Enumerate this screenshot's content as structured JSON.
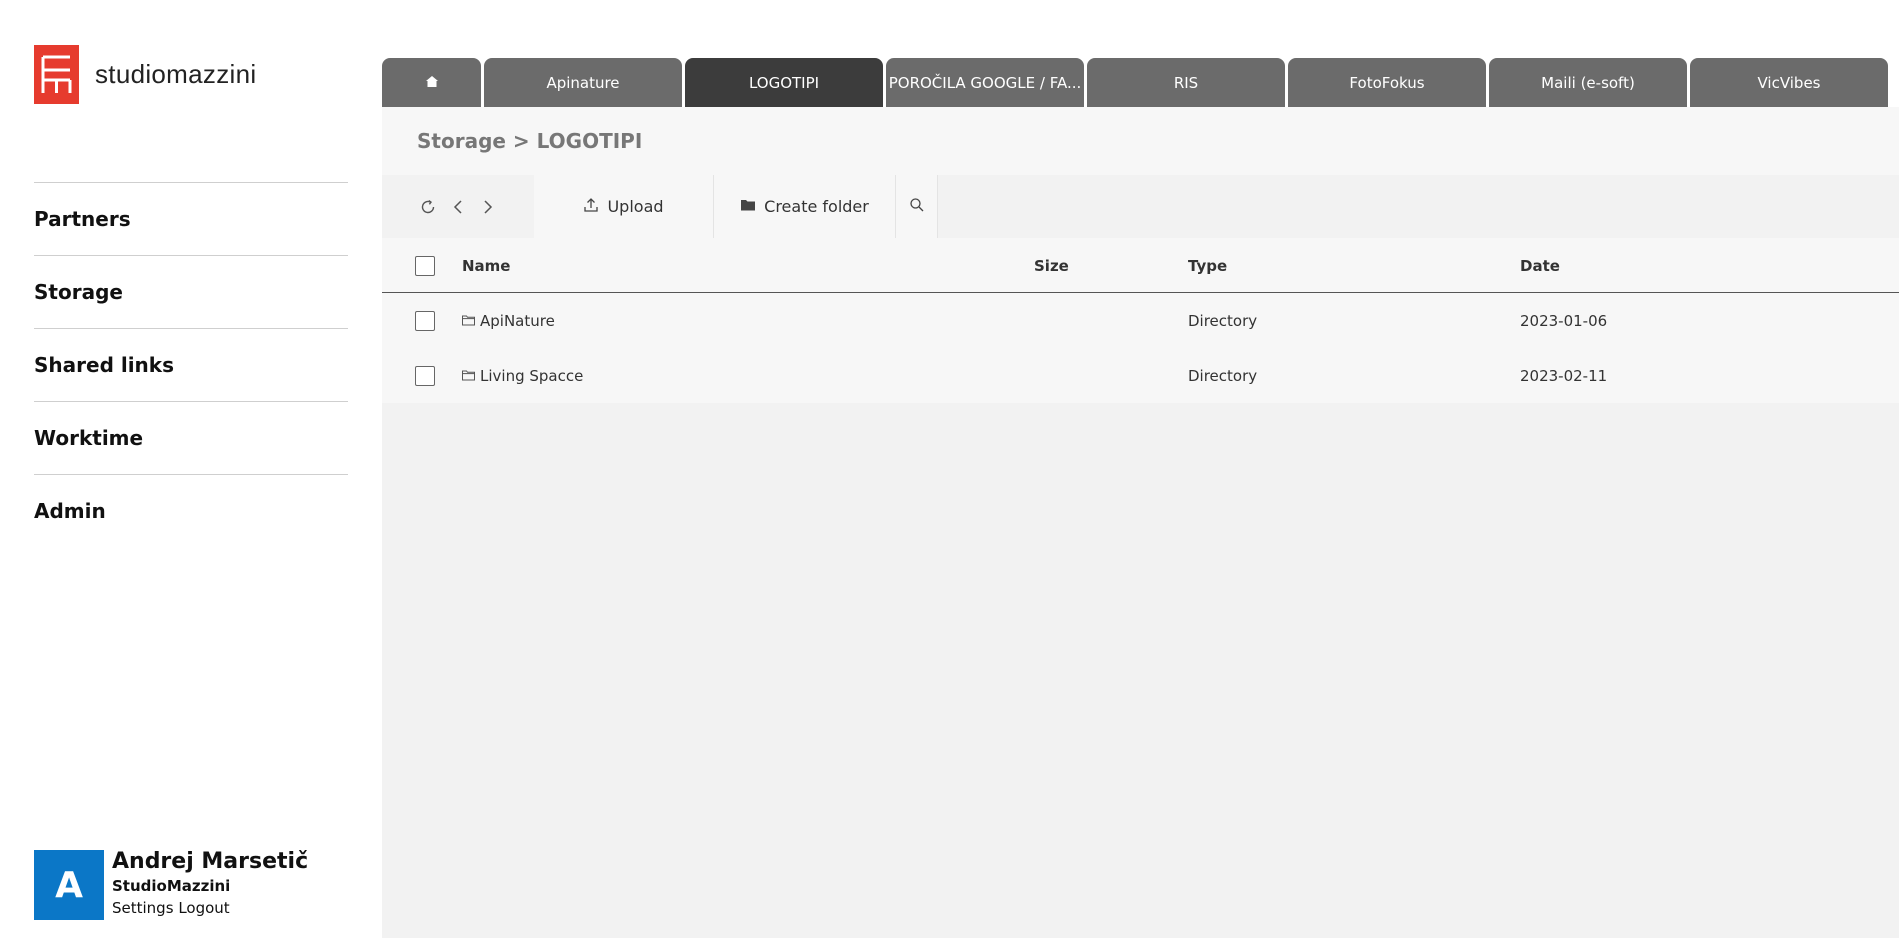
{
  "brand": {
    "name": "studiomazzini",
    "logo_color": "#e63b2e"
  },
  "sidebar": {
    "items": [
      {
        "label": "Partners"
      },
      {
        "label": "Storage"
      },
      {
        "label": "Shared links"
      },
      {
        "label": "Worktime"
      },
      {
        "label": "Admin"
      }
    ]
  },
  "user": {
    "initial": "A",
    "name": "Andrej Marsetič",
    "company": "StudioMazzini",
    "settings_label": "Settings",
    "logout_label": "Logout",
    "avatar_color": "#0b77c7"
  },
  "tabs": [
    {
      "label": "",
      "icon": "home-icon"
    },
    {
      "label": "Apinature"
    },
    {
      "label": "LOGOTIPI",
      "active": true
    },
    {
      "label": "POROČILA GOOGLE / FA..."
    },
    {
      "label": "RIS"
    },
    {
      "label": "FotoFokus"
    },
    {
      "label": "Maili (e-soft)"
    },
    {
      "label": "VicVibes"
    }
  ],
  "breadcrumb": "Storage > LOGOTIPI",
  "toolbar": {
    "upload_label": "Upload",
    "create_folder_label": "Create folder"
  },
  "table": {
    "columns": {
      "name": "Name",
      "size": "Size",
      "type": "Type",
      "date": "Date"
    },
    "rows": [
      {
        "name": "ApiNature",
        "size": "",
        "type": "Directory",
        "date": "2023-01-06"
      },
      {
        "name": "Living Spacce",
        "size": "",
        "type": "Directory",
        "date": "2023-02-11"
      }
    ]
  }
}
